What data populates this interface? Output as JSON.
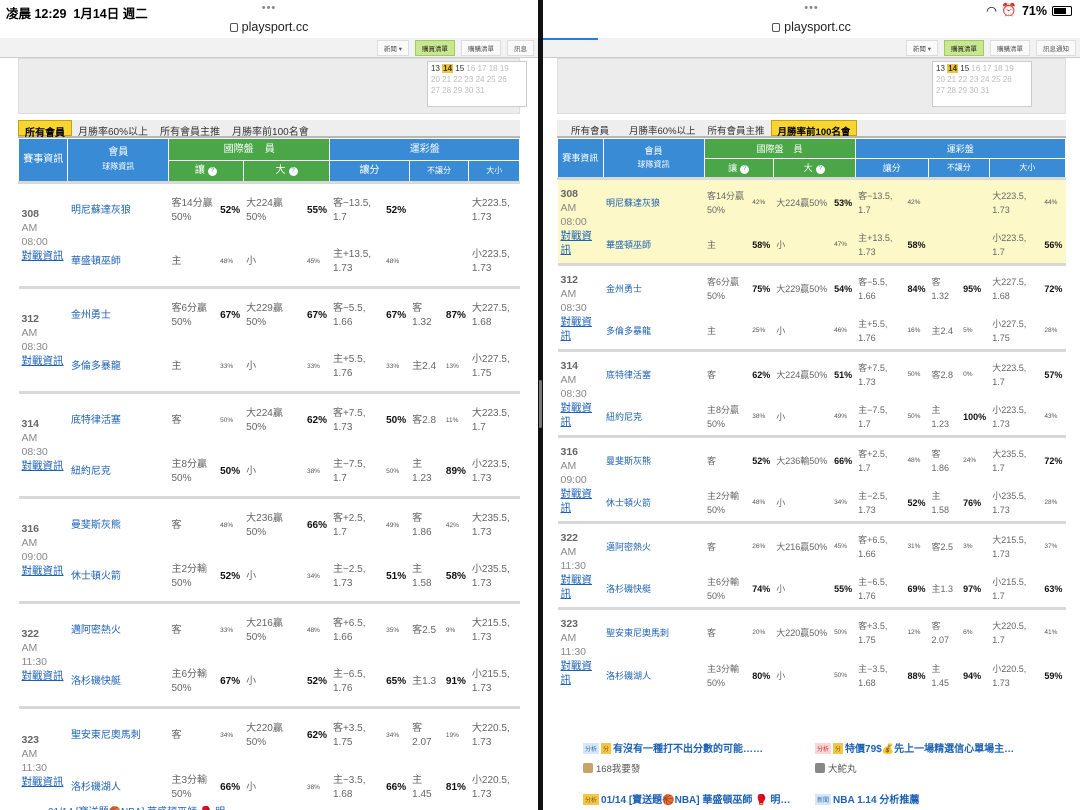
{
  "status": {
    "time": "凌晨 12:29",
    "date": "1月14日 週二",
    "battery": "71%",
    "dots": "•••"
  },
  "url": "playsport.cc",
  "topnav": {
    "left": [
      "新聞 ▾",
      "購買清單",
      "購購清單",
      "訊息"
    ],
    "right": [
      "新聞 ▾",
      "購買清單",
      "購購清單",
      "訊息通知"
    ]
  },
  "calendar": {
    "row1": [
      "13",
      "14",
      "15",
      "16",
      "17",
      "18",
      "19"
    ],
    "row2": [
      "20",
      "21",
      "22",
      "23",
      "24",
      "25",
      "26"
    ],
    "row3": [
      "27",
      "28",
      "29",
      "30",
      "31"
    ]
  },
  "tabs": {
    "all": "所有會員",
    "m60": "月勝率60%以上",
    "main": "所有會員主推",
    "top100": "月勝率前100名會"
  },
  "header": {
    "info": "賽事資訊",
    "member": "會員",
    "member_sub": "球隊資訊",
    "intl": "國際盤",
    "intl_extra": "員",
    "sports": "運彩盤",
    "rang": "讓",
    "da": "大",
    "rangfen": "讓分",
    "burang": "不讓分",
    "daxiao": "大小"
  },
  "left_games": [
    {
      "no": "308",
      "ampm": "AM",
      "time": "08:00",
      "link": "對戰資訊",
      "rows": [
        {
          "team": "明尼蘇達灰狼",
          "rang": "客14分贏50%",
          "rp": "52%",
          "rpb": true,
          "da": "大224贏50%",
          "dp": "55%",
          "dpb": true,
          "rf": "客−13.5, 1.7",
          "rfp": "52%",
          "rfpb": true,
          "br": "",
          "brp": "",
          "brpb": false,
          "dx": "大223.5, 1.73"
        },
        {
          "team": "華盛頓巫師",
          "rang": "主",
          "rp": "48%",
          "rpb": false,
          "da": "小",
          "dp": "45%",
          "dpb": false,
          "rf": "主+13.5, 1.73",
          "rfp": "48%",
          "rfpb": false,
          "br": "",
          "brp": "",
          "brpb": false,
          "dx": "小223.5, 1.73"
        }
      ]
    },
    {
      "no": "312",
      "ampm": "AM",
      "time": "08:30",
      "link": "對戰資訊",
      "rows": [
        {
          "team": "金州勇士",
          "rang": "客6分贏50%",
          "rp": "67%",
          "rpb": true,
          "da": "大229贏50%",
          "dp": "67%",
          "dpb": true,
          "rf": "客−5.5, 1.66",
          "rfp": "67%",
          "rfpb": true,
          "br": "客1.32",
          "brp": "87%",
          "brpb": true,
          "dx": "大227.5, 1.68"
        },
        {
          "team": "多倫多暴龍",
          "rang": "主",
          "rp": "33%",
          "rpb": false,
          "da": "小",
          "dp": "33%",
          "dpb": false,
          "rf": "主+5.5, 1.76",
          "rfp": "33%",
          "rfpb": false,
          "br": "主2.4",
          "brp": "13%",
          "brpb": false,
          "dx": "小227.5, 1.75"
        }
      ]
    },
    {
      "no": "314",
      "ampm": "AM",
      "time": "08:30",
      "link": "對戰資訊",
      "rows": [
        {
          "team": "底特律活塞",
          "rang": "客",
          "rp": "50%",
          "rpb": false,
          "da": "大224贏50%",
          "dp": "62%",
          "dpb": true,
          "rf": "客+7.5, 1.73",
          "rfp": "50%",
          "rfpb": true,
          "br": "客2.8",
          "brp": "11%",
          "brpb": false,
          "dx": "大223.5, 1.7"
        },
        {
          "team": "紐約尼克",
          "rang": "主8分贏50%",
          "rp": "50%",
          "rpb": true,
          "da": "小",
          "dp": "38%",
          "dpb": false,
          "rf": "主−7.5, 1.7",
          "rfp": "50%",
          "rfpb": false,
          "br": "主1.23",
          "brp": "89%",
          "brpb": true,
          "dx": "小223.5, 1.73"
        }
      ]
    },
    {
      "no": "316",
      "ampm": "AM",
      "time": "09:00",
      "link": "對戰資訊",
      "rows": [
        {
          "team": "曼斐斯灰熊",
          "rang": "客",
          "rp": "48%",
          "rpb": false,
          "da": "大236贏50%",
          "dp": "66%",
          "dpb": true,
          "rf": "客+2.5, 1.7",
          "rfp": "49%",
          "rfpb": false,
          "br": "客1.86",
          "brp": "42%",
          "brpb": false,
          "dx": "大235.5, 1.73"
        },
        {
          "team": "休士頓火箭",
          "rang": "主2分輸50%",
          "rp": "52%",
          "rpb": true,
          "da": "小",
          "dp": "34%",
          "dpb": false,
          "rf": "主−2.5, 1.73",
          "rfp": "51%",
          "rfpb": true,
          "br": "主1.58",
          "brp": "58%",
          "brpb": true,
          "dx": "小235.5, 1.73"
        }
      ]
    },
    {
      "no": "322",
      "ampm": "AM",
      "time": "11:30",
      "link": "對戰資訊",
      "rows": [
        {
          "team": "邁阿密熱火",
          "rang": "客",
          "rp": "33%",
          "rpb": false,
          "da": "大216贏50%",
          "dp": "48%",
          "dpb": false,
          "rf": "客+6.5, 1.66",
          "rfp": "35%",
          "rfpb": false,
          "br": "客2.5",
          "brp": "9%",
          "brpb": false,
          "dx": "大215.5, 1.73"
        },
        {
          "team": "洛杉磯快艇",
          "rang": "主6分輸50%",
          "rp": "67%",
          "rpb": true,
          "da": "小",
          "dp": "52%",
          "dpb": true,
          "rf": "主−6.5, 1.76",
          "rfp": "65%",
          "rfpb": true,
          "br": "主1.3",
          "brp": "91%",
          "brpb": true,
          "dx": "小215.5, 1.73"
        }
      ]
    },
    {
      "no": "323",
      "ampm": "AM",
      "time": "11:30",
      "link": "對戰資訊",
      "rows": [
        {
          "team": "聖安東尼奧馬刺",
          "rang": "客",
          "rp": "34%",
          "rpb": false,
          "da": "大220贏50%",
          "dp": "62%",
          "dpb": true,
          "rf": "客+3.5, 1.75",
          "rfp": "34%",
          "rfpb": false,
          "br": "客2.07",
          "brp": "19%",
          "brpb": false,
          "dx": "大220.5, 1.73"
        },
        {
          "team": "洛杉磯湖人",
          "rang": "主3分輸50%",
          "rp": "66%",
          "rpb": true,
          "da": "小",
          "dp": "38%",
          "dpb": false,
          "rf": "主−3.5, 1.68",
          "rfp": "66%",
          "rfpb": true,
          "br": "主1.45",
          "brp": "81%",
          "brpb": true,
          "dx": "小220.5, 1.73"
        }
      ]
    }
  ],
  "right_games": [
    {
      "no": "308",
      "ampm": "AM",
      "time": "08:00",
      "link": "對戰資訊",
      "yellow": true,
      "rows": [
        {
          "team": "明尼蘇達灰狼",
          "rang": "客14分贏50%",
          "rp": "42%",
          "rpb": false,
          "da": "大224贏50%",
          "dp": "53%",
          "dpb": true,
          "rf": "客−13.5, 1.7",
          "rfp": "42%",
          "rfpb": false,
          "br": "",
          "brp": "",
          "brpb": false,
          "dx": "大223.5, 1.73",
          "dxp": "44%",
          "dxpb": false
        },
        {
          "team": "華盛頓巫師",
          "rang": "主",
          "rp": "58%",
          "rpb": true,
          "da": "小",
          "dp": "47%",
          "dpb": false,
          "rf": "主+13.5, 1.73",
          "rfp": "58%",
          "rfpb": true,
          "br": "",
          "brp": "",
          "brpb": false,
          "dx": "小223.5, 1.7",
          "dxp": "56%",
          "dxpb": true
        }
      ]
    },
    {
      "no": "312",
      "ampm": "AM",
      "time": "08:30",
      "link": "對戰資訊",
      "yellow": false,
      "rows": [
        {
          "team": "金州勇士",
          "rang": "客6分贏50%",
          "rp": "75%",
          "rpb": true,
          "da": "大229贏50%",
          "dp": "54%",
          "dpb": true,
          "rf": "客−5.5, 1.66",
          "rfp": "84%",
          "rfpb": true,
          "br": "客1.32",
          "brp": "95%",
          "brpb": true,
          "dx": "大227.5, 1.68",
          "dxp": "72%",
          "dxpb": true
        },
        {
          "team": "多倫多暴龍",
          "rang": "主",
          "rp": "25%",
          "rpb": false,
          "da": "小",
          "dp": "46%",
          "dpb": false,
          "rf": "主+5.5, 1.76",
          "rfp": "16%",
          "rfpb": false,
          "br": "主2.4",
          "brp": "5%",
          "brpb": false,
          "dx": "小227.5, 1.75",
          "dxp": "28%",
          "dxpb": false
        }
      ]
    },
    {
      "no": "314",
      "ampm": "AM",
      "time": "08:30",
      "link": "對戰資訊",
      "yellow": false,
      "rows": [
        {
          "team": "底特律活塞",
          "rang": "客",
          "rp": "62%",
          "rpb": true,
          "da": "大224贏50%",
          "dp": "51%",
          "dpb": true,
          "rf": "客+7.5, 1.73",
          "rfp": "50%",
          "rfpb": false,
          "br": "客2.8",
          "brp": "0%",
          "brpb": false,
          "dx": "大223.5, 1.7",
          "dxp": "57%",
          "dxpb": true
        },
        {
          "team": "紐約尼克",
          "rang": "主8分贏50%",
          "rp": "38%",
          "rpb": false,
          "da": "小",
          "dp": "49%",
          "dpb": false,
          "rf": "主−7.5, 1.7",
          "rfp": "50%",
          "rfpb": false,
          "br": "主1.23",
          "brp": "100%",
          "brpb": true,
          "dx": "小223.5, 1.73",
          "dxp": "43%",
          "dxpb": false
        }
      ]
    },
    {
      "no": "316",
      "ampm": "AM",
      "time": "09:00",
      "link": "對戰資訊",
      "yellow": false,
      "rows": [
        {
          "team": "曼斐斯灰熊",
          "rang": "客",
          "rp": "52%",
          "rpb": true,
          "da": "大236輸50%",
          "dp": "66%",
          "dpb": true,
          "rf": "客+2.5, 1.7",
          "rfp": "48%",
          "rfpb": false,
          "br": "客1.86",
          "brp": "24%",
          "brpb": false,
          "dx": "大235.5, 1.7",
          "dxp": "72%",
          "dxpb": true
        },
        {
          "team": "休士頓火箭",
          "rang": "主2分輸50%",
          "rp": "48%",
          "rpb": false,
          "da": "小",
          "dp": "34%",
          "dpb": false,
          "rf": "主−2.5, 1.73",
          "rfp": "52%",
          "rfpb": true,
          "br": "主1.58",
          "brp": "76%",
          "brpb": true,
          "dx": "小235.5, 1.73",
          "dxp": "28%",
          "dxpb": false
        }
      ]
    },
    {
      "no": "322",
      "ampm": "AM",
      "time": "11:30",
      "link": "對戰資訊",
      "yellow": false,
      "rows": [
        {
          "team": "邁阿密熱火",
          "rang": "客",
          "rp": "26%",
          "rpb": false,
          "da": "大216贏50%",
          "dp": "45%",
          "dpb": false,
          "rf": "客+6.5, 1.66",
          "rfp": "31%",
          "rfpb": false,
          "br": "客2.5",
          "brp": "3%",
          "brpb": false,
          "dx": "大215.5, 1.73",
          "dxp": "37%",
          "dxpb": false
        },
        {
          "team": "洛杉磯快艇",
          "rang": "主6分輸50%",
          "rp": "74%",
          "rpb": true,
          "da": "小",
          "dp": "55%",
          "dpb": true,
          "rf": "主−6.5, 1.76",
          "rfp": "69%",
          "rfpb": true,
          "br": "主1.3",
          "brp": "97%",
          "brpb": true,
          "dx": "小215.5, 1.7",
          "dxp": "63%",
          "dxpb": true
        }
      ]
    },
    {
      "no": "323",
      "ampm": "AM",
      "time": "11:30",
      "link": "對戰資訊",
      "yellow": false,
      "rows": [
        {
          "team": "聖安東尼奧馬刺",
          "rang": "客",
          "rp": "20%",
          "rpb": false,
          "da": "大220贏50%",
          "dp": "50%",
          "dpb": false,
          "rf": "客+3.5, 1.75",
          "rfp": "12%",
          "rfpb": false,
          "br": "客2.07",
          "brp": "6%",
          "brpb": false,
          "dx": "大220.5, 1.7",
          "dxp": "41%",
          "dxpb": false
        },
        {
          "team": "洛杉磯湖人",
          "rang": "主3分輸50%",
          "rp": "80%",
          "rpb": true,
          "da": "小",
          "dp": "50%",
          "dpb": false,
          "rf": "主−3.5, 1.68",
          "rfp": "88%",
          "rfpb": true,
          "br": "主1.45",
          "brp": "94%",
          "brpb": true,
          "dx": "小220.5, 1.73",
          "dxp": "59%",
          "dxpb": true
        }
      ]
    }
  ],
  "news": {
    "n1_tag": "分析",
    "n1_title": "有沒有一種打不出分數的可能……",
    "n1_by": "168我要發",
    "n2_tag": "分析",
    "n2_title": "特價79$💰先上一場精選信心單場主…",
    "n2_by": "大鮀丸",
    "n3_tag": "分析",
    "n3_title": "01/14 [寶送題🏀NBA] 華盛頓巫師 🥊 明…",
    "n4_tag": "新聞",
    "n4_title": "NBA 1.14 分析推薦"
  }
}
